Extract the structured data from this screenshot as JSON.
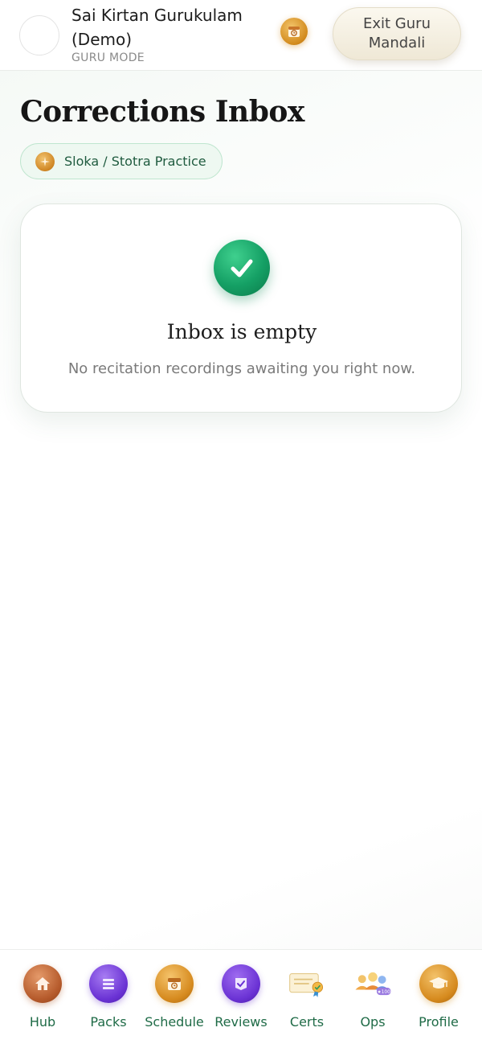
{
  "header": {
    "org_name": "Sai Kirtan Gurukulam (Demo)",
    "mode": "GURU MODE",
    "calendar_icon": "calendar-clock-icon",
    "exit_label": "Exit Guru Mandali"
  },
  "main": {
    "title": "Corrections Inbox",
    "filter_chip": {
      "label": "Sloka / Stotra Practice",
      "icon": "sparkle-icon"
    },
    "empty_state": {
      "icon": "check-circle-icon",
      "title": "Inbox is empty",
      "subtitle": "No recitation recordings awaiting you right now."
    }
  },
  "bottom_nav": {
    "items": [
      {
        "label": "Hub",
        "icon": "home-icon"
      },
      {
        "label": "Packs",
        "icon": "stack-icon"
      },
      {
        "label": "Schedule",
        "icon": "calendar-icon"
      },
      {
        "label": "Reviews",
        "icon": "review-check-icon"
      },
      {
        "label": "Certs",
        "icon": "certificate-icon"
      },
      {
        "label": "Ops",
        "icon": "team-icon"
      },
      {
        "label": "Profile",
        "icon": "graduation-cap-icon"
      }
    ]
  },
  "colors": {
    "accent_green": "#1f6b47",
    "success_green": "#15a065",
    "gold": "#d68a1e",
    "purple": "#6a32d4"
  }
}
